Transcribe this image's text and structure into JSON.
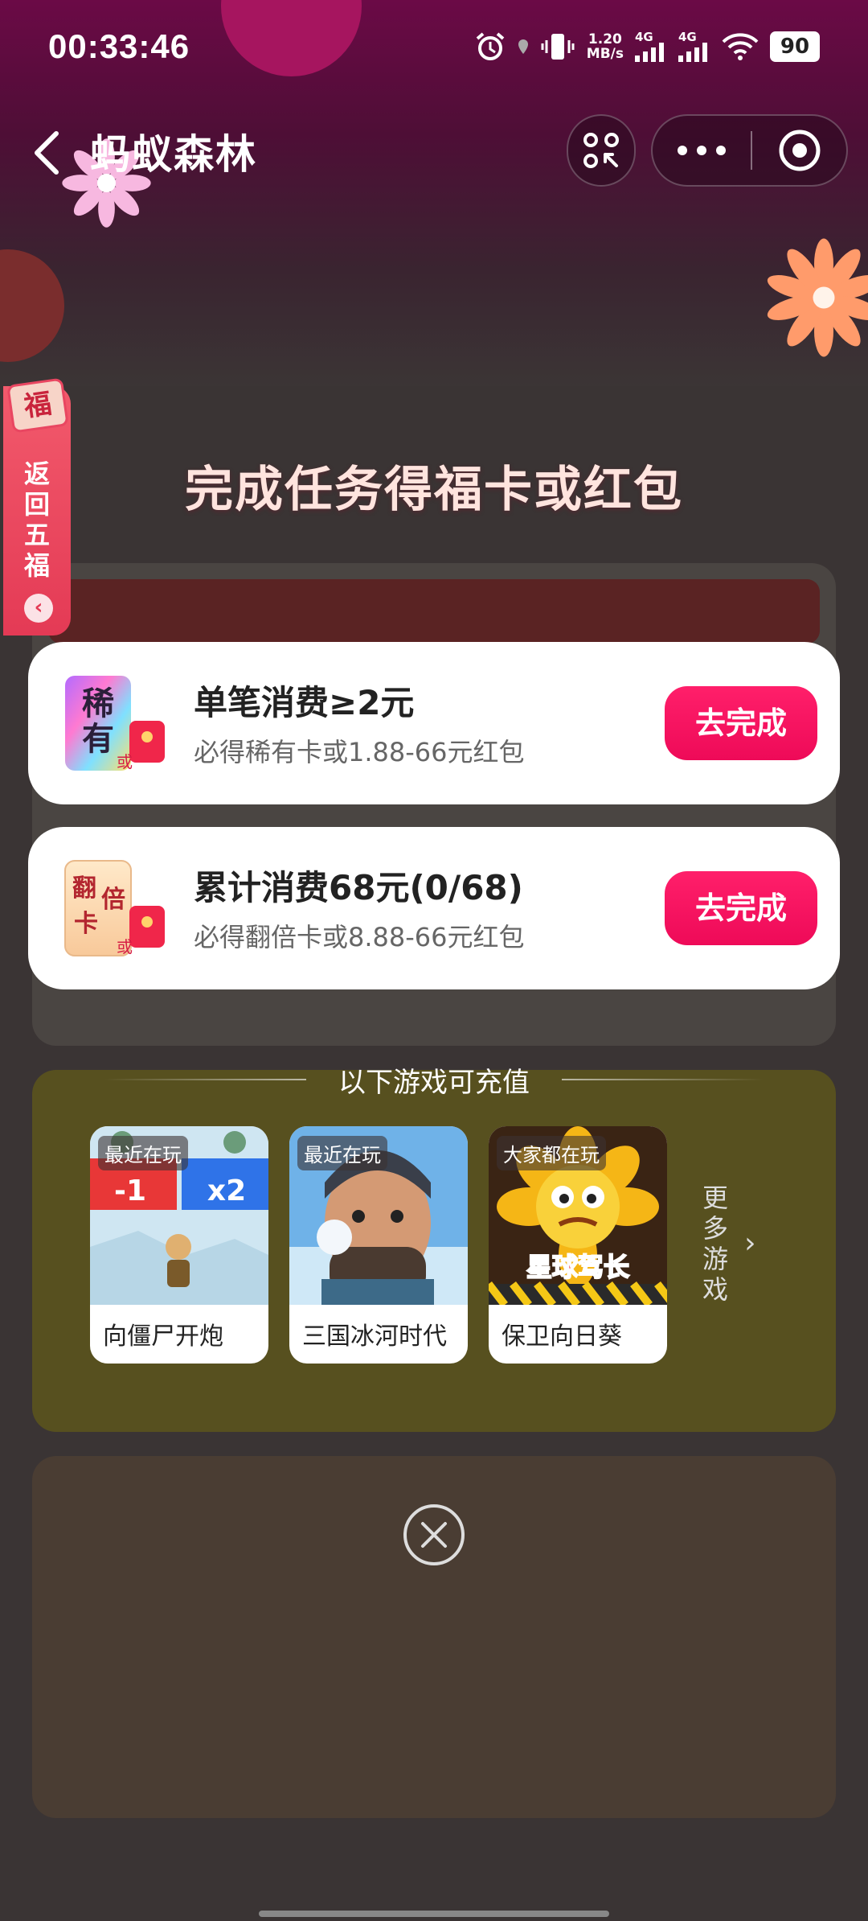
{
  "status_bar": {
    "time": "00:33:46",
    "net_speed_value": "1.20",
    "net_speed_unit": "MB/s",
    "signal1_label": "4G",
    "signal2_label": "4G",
    "battery": "90"
  },
  "nav": {
    "title": "蚂蚁森林"
  },
  "side_tab": {
    "badge": "福",
    "label_lines": [
      "返",
      "回",
      "五",
      "福"
    ],
    "arrow": "‹"
  },
  "popup": {
    "title": "完成任务得福卡或红包",
    "tasks": [
      {
        "title": "单笔消费≥2元",
        "subtitle": "必得稀有卡或1.88-66元红包",
        "button": "去完成",
        "icon_text": [
          "稀",
          "有"
        ],
        "icon_or": "或"
      },
      {
        "title": "累计消费68元(0/68)",
        "subtitle": "必得翻倍卡或8.88-66元红包",
        "button": "去完成",
        "icon_text": [
          "翻",
          "倍",
          "卡"
        ],
        "icon_or": "或"
      }
    ],
    "games_header": "以下游戏可充值",
    "games": [
      {
        "tag": "最近在玩",
        "name": "向僵尸开炮",
        "thumb_left": "-1",
        "thumb_right": "x2"
      },
      {
        "tag": "最近在玩",
        "name": "三国冰河时代"
      },
      {
        "tag": "大家都在玩",
        "name": "保卫向日葵",
        "thumb_logo": "星球驾长"
      }
    ],
    "more_games": [
      "更",
      "多",
      "游",
      "戏"
    ]
  },
  "colors": {
    "accent": "#ee0a58",
    "side_tab": "#e43a55",
    "title_text": "#ffe4de"
  }
}
